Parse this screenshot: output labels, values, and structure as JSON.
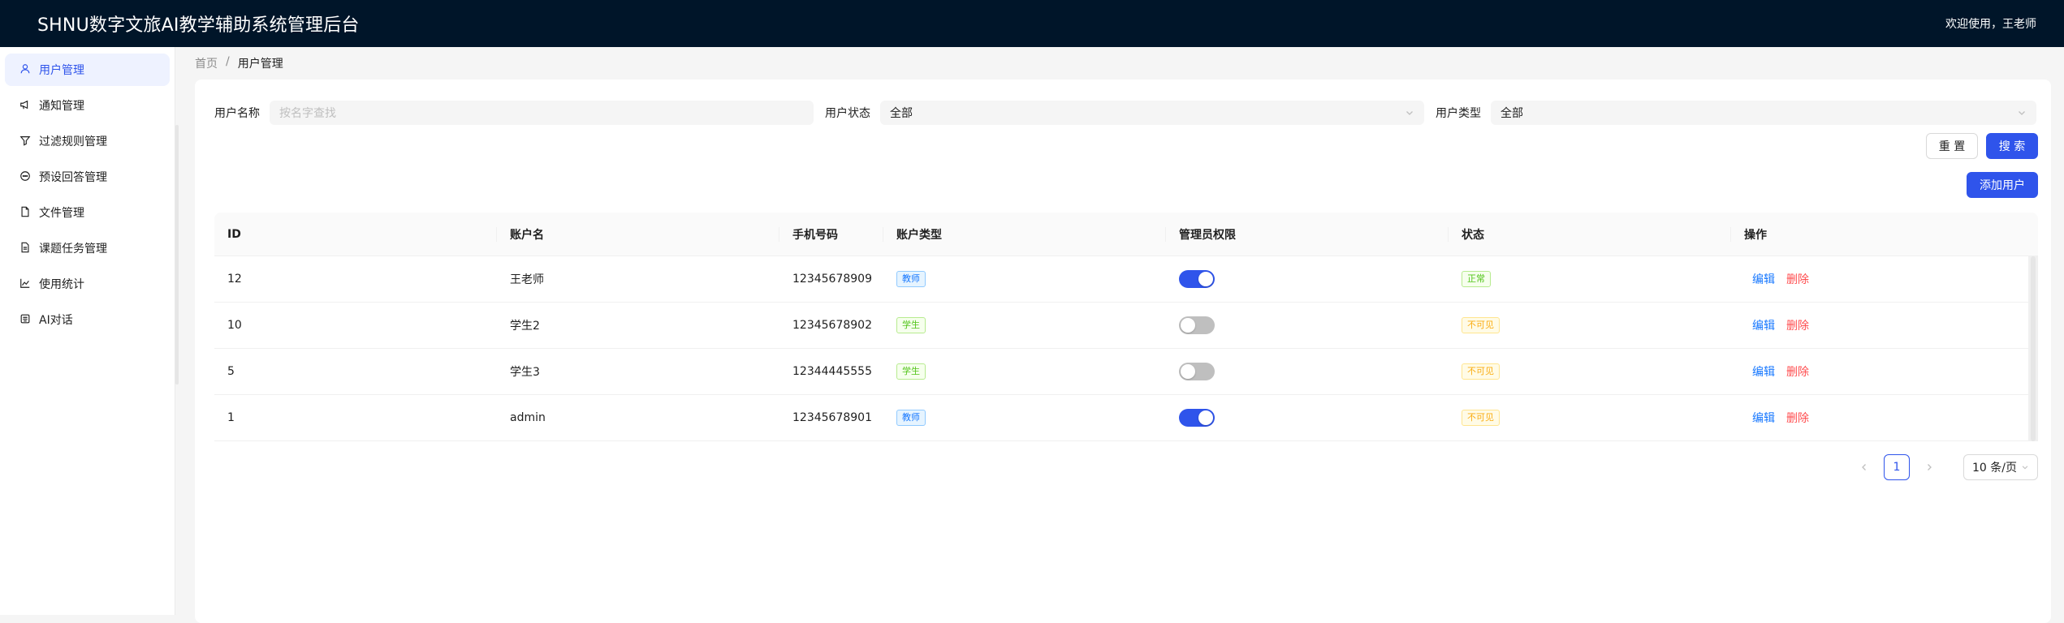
{
  "header": {
    "title": "SHNU数字文旅AI教学辅助系统管理后台",
    "welcome": "欢迎使用，王老师"
  },
  "sidebar": {
    "items": [
      {
        "label": "用户管理",
        "icon": "user-icon",
        "active": true
      },
      {
        "label": "通知管理",
        "icon": "megaphone-icon",
        "active": false
      },
      {
        "label": "过滤规则管理",
        "icon": "filter-icon",
        "active": false
      },
      {
        "label": "预设回答管理",
        "icon": "message-icon",
        "active": false
      },
      {
        "label": "文件管理",
        "icon": "file-icon",
        "active": false
      },
      {
        "label": "课题任务管理",
        "icon": "file-text-icon",
        "active": false
      },
      {
        "label": "使用统计",
        "icon": "line-chart-icon",
        "active": false
      },
      {
        "label": "AI对话",
        "icon": "robot-icon",
        "active": false
      }
    ]
  },
  "breadcrumb": {
    "home": "首页",
    "separator": "/",
    "current": "用户管理"
  },
  "filters": {
    "name_label": "用户名称",
    "name_placeholder": "按名字查找",
    "status_label": "用户状态",
    "status_value": "全部",
    "type_label": "用户类型",
    "type_value": "全部"
  },
  "buttons": {
    "reset": "重 置",
    "search": "搜 索",
    "add_user": "添加用户"
  },
  "table": {
    "columns": [
      "ID",
      "账户名",
      "手机号码",
      "账户类型",
      "管理员权限",
      "状态",
      "操作"
    ],
    "rows": [
      {
        "id": "12",
        "account": "王老师",
        "phone": "12345678909",
        "type": "教师",
        "admin": true,
        "status": "正常"
      },
      {
        "id": "10",
        "account": "学生2",
        "phone": "12345678902",
        "type": "学生",
        "admin": false,
        "status": "不可见"
      },
      {
        "id": "5",
        "account": "学生3",
        "phone": "12344445555",
        "type": "学生",
        "admin": false,
        "status": "不可见"
      },
      {
        "id": "1",
        "account": "admin",
        "phone": "12345678901",
        "type": "教师",
        "admin": true,
        "status": "不可见"
      }
    ],
    "edit_label": "编辑",
    "delete_label": "删除"
  },
  "pagination": {
    "current_page": "1",
    "page_size": "10 条/页"
  },
  "colors": {
    "header_bg": "#001529",
    "primary": "#2f54eb",
    "danger": "#ff4d4f",
    "tag_teacher": "#1677ff",
    "tag_student": "#52c41a",
    "tag_hidden": "#faad14"
  }
}
